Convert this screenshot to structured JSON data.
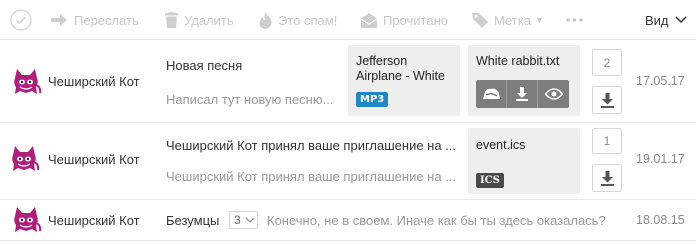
{
  "toolbar": {
    "forward_label": "Переслать",
    "delete_label": "Удалить",
    "spam_label": "Это спам!",
    "read_label": "Прочитано",
    "tag_label": "Метка",
    "view_label": "Вид"
  },
  "colors": {
    "accent_blue": "#1e88c7",
    "avatar_purple": "#b0207a",
    "toolbar_disabled": "#c8c8c8"
  },
  "messages": [
    {
      "sender": "Чеширский Кот",
      "subject": "Новая песня",
      "snippet": "Написал тут новую песню...",
      "date": "17.05.17",
      "attachment_count": "2",
      "attachments": [
        {
          "title_line1": "Jefferson",
          "title_line2": "Airplane - White",
          "badge": "MP3"
        },
        {
          "title": "White rabbit.txt"
        }
      ]
    },
    {
      "sender": "Чеширский Кот",
      "subject": "Чеширский Кот принял ваше приглашение на ...",
      "snippet": "Чеширский Кот принял ваше приглашение на ...",
      "date": "19.01.17",
      "attachment_count": "1",
      "attachments": [
        {
          "title": "event.ics",
          "badge": "ICS"
        }
      ]
    },
    {
      "sender": "Чеширский Кот",
      "subject": "Безумцы",
      "thread_count": "3",
      "snippet": "Конечно, не в своем. Иначе как бы ты здесь оказалась?",
      "date": "18.08.15"
    }
  ]
}
